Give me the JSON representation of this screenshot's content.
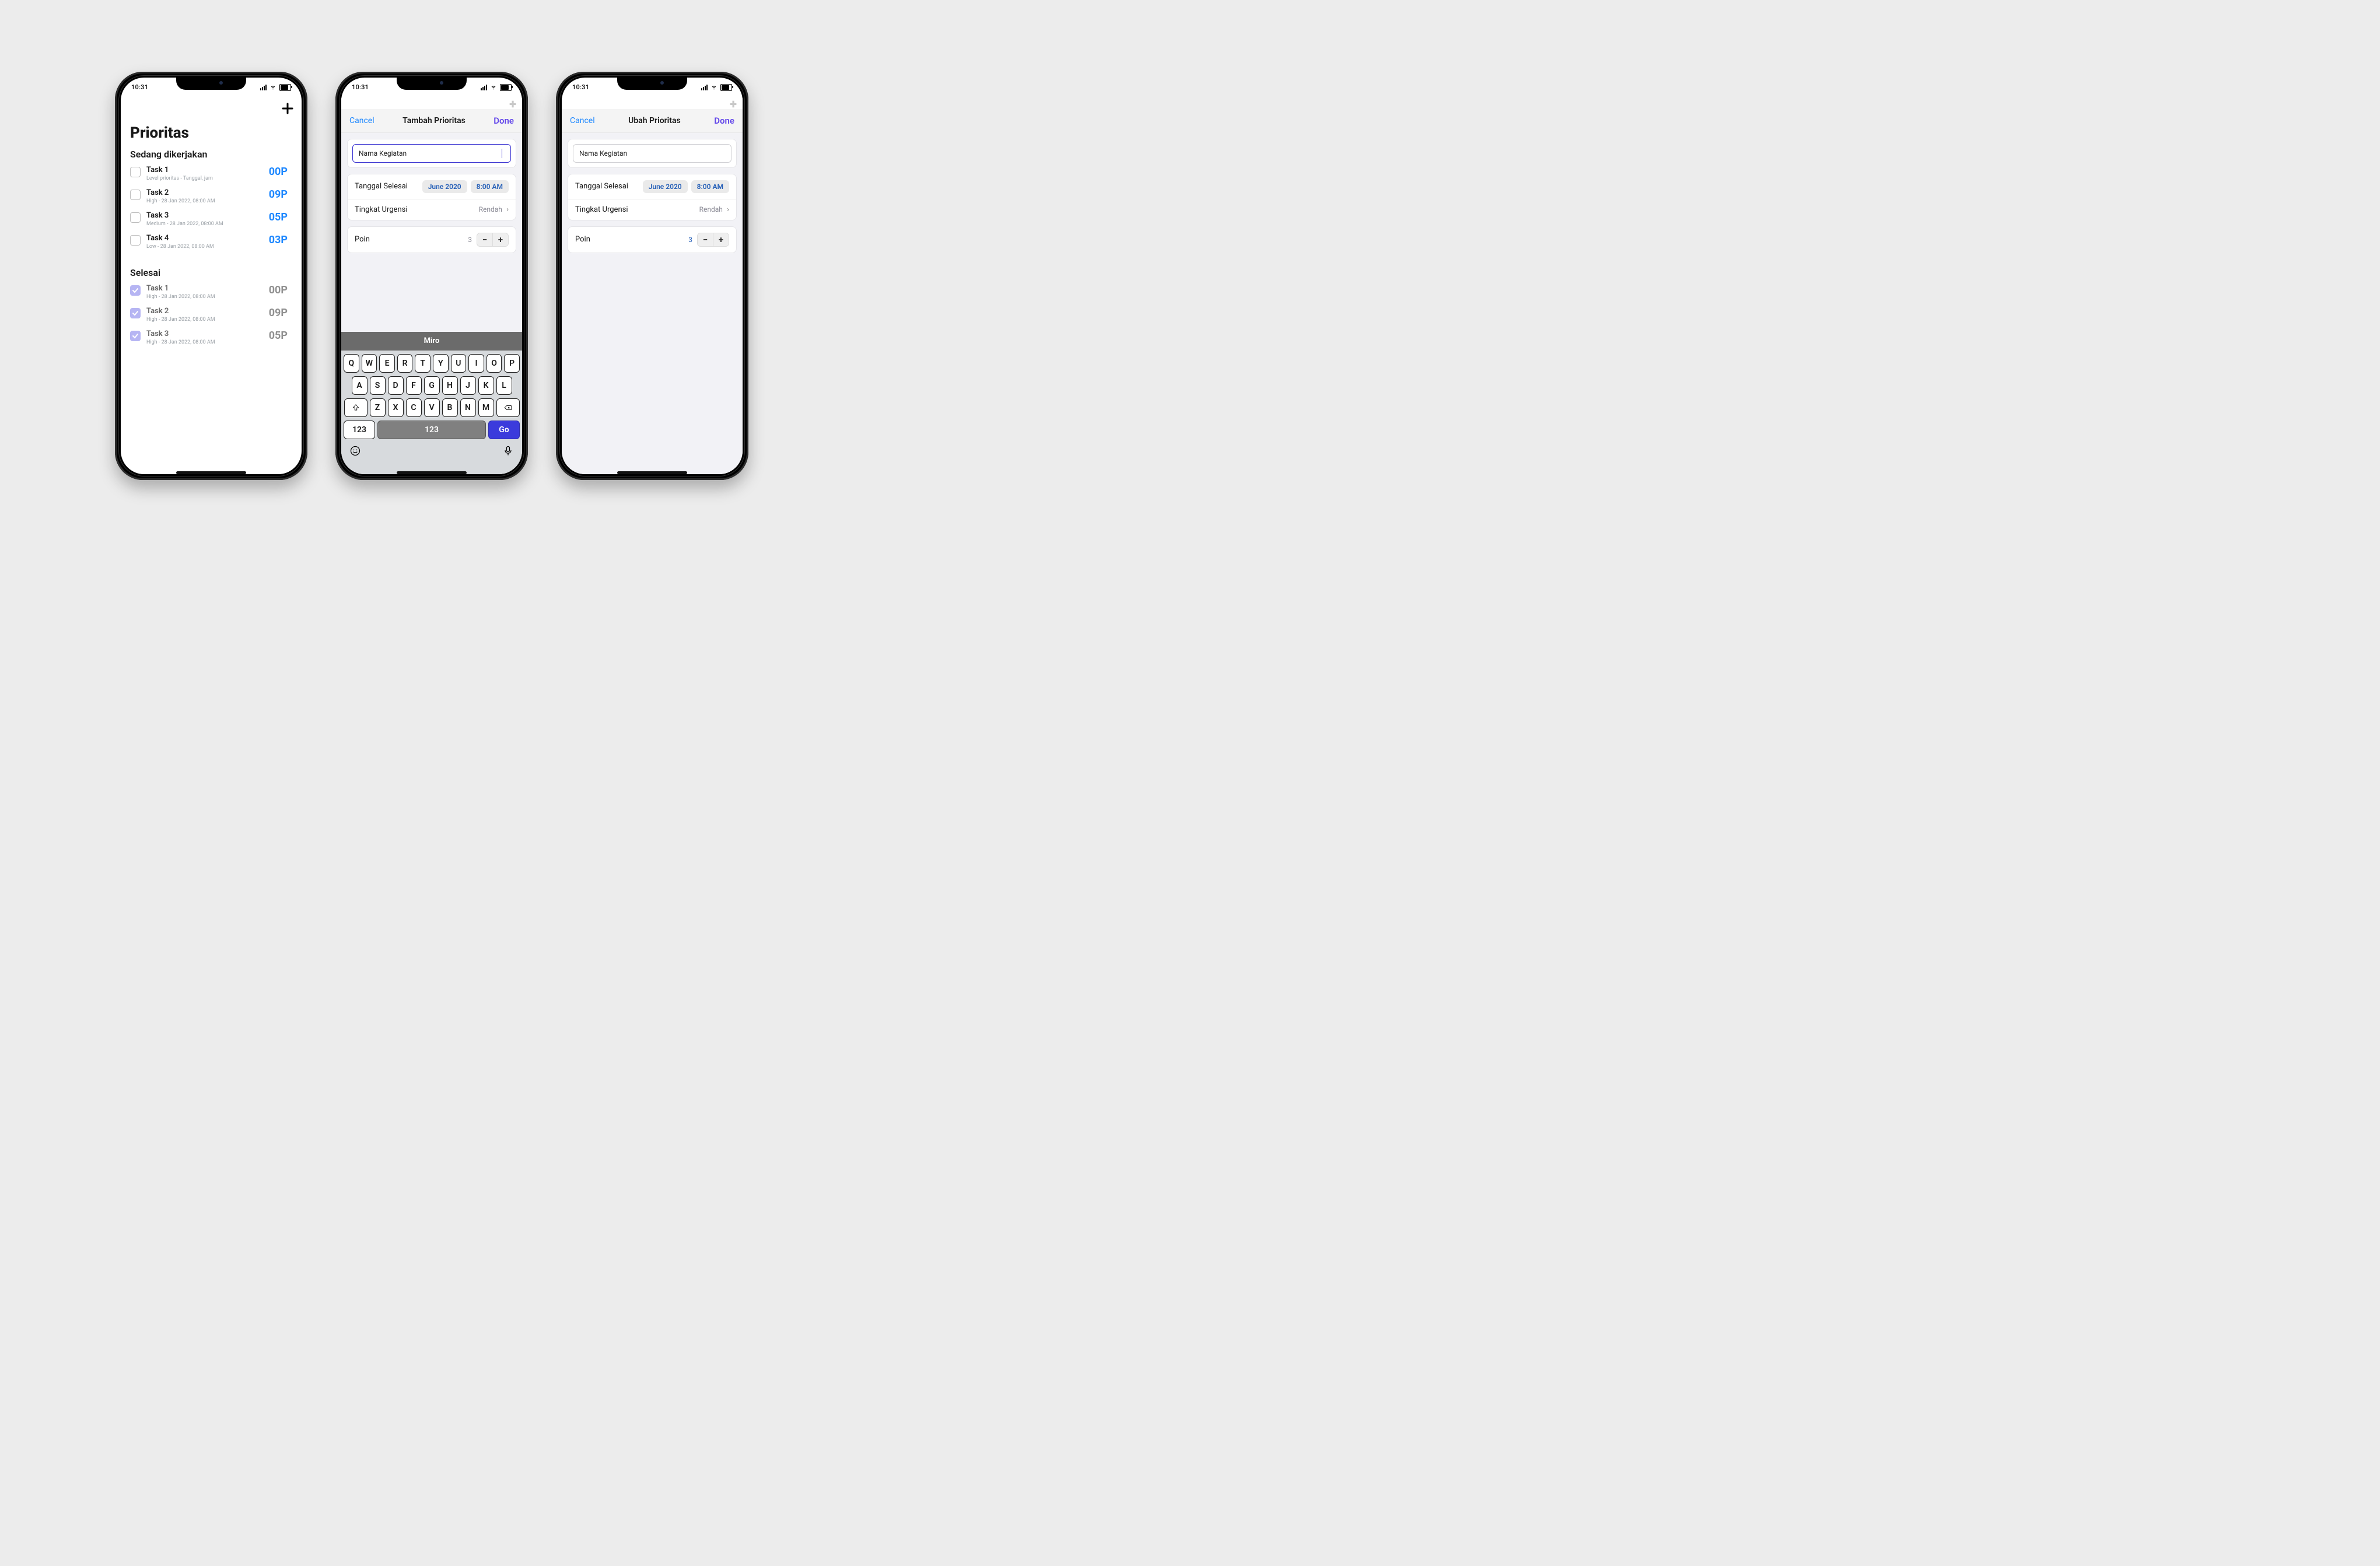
{
  "status": {
    "time": "10:31"
  },
  "screen1": {
    "title": "Prioritas",
    "sections": {
      "working": {
        "title": "Sedang dikerjakan",
        "tasks": [
          {
            "name": "Task 1",
            "meta": "Level prioritas - Tanggal, jam",
            "points": "00P"
          },
          {
            "name": "Task 2",
            "meta": "High - 28 Jan 2022, 08:00 AM",
            "points": "09P"
          },
          {
            "name": "Task 3",
            "meta": "Medium - 28 Jan 2022, 08:00 AM",
            "points": "05P"
          },
          {
            "name": "Task 4",
            "meta": "Low - 28 Jan 2022, 08:00 AM",
            "points": "03P"
          }
        ]
      },
      "done": {
        "title": "Selesai",
        "tasks": [
          {
            "name": "Task 1",
            "meta": "High - 28 Jan 2022, 08:00 AM",
            "points": "00P"
          },
          {
            "name": "Task 2",
            "meta": "High - 28 Jan 2022, 08:00 AM",
            "points": "09P"
          },
          {
            "name": "Task 3",
            "meta": "High - 28 Jan 2022, 08:00 AM",
            "points": "05P"
          }
        ]
      }
    }
  },
  "screen2": {
    "header": {
      "cancel": "Cancel",
      "title": "Tambah Prioritas",
      "done": "Done"
    },
    "name_input": {
      "placeholder": "Nama Kegiatan",
      "value": ""
    },
    "date": {
      "label": "Tanggal Selesai",
      "month": "June 2020",
      "time": "8:00 AM"
    },
    "urgency": {
      "label": "Tingkat Urgensi",
      "value": "Rendah"
    },
    "points": {
      "label": "Poin",
      "value": "3"
    },
    "keyboard": {
      "suggestion": "Miro",
      "row1": [
        "Q",
        "W",
        "E",
        "R",
        "T",
        "Y",
        "U",
        "I",
        "O",
        "P"
      ],
      "row2": [
        "A",
        "S",
        "D",
        "F",
        "G",
        "H",
        "J",
        "K",
        "L"
      ],
      "row3": [
        "Z",
        "X",
        "C",
        "V",
        "B",
        "N",
        "M"
      ],
      "key_123": "123",
      "key_space": "123",
      "key_go": "Go"
    }
  },
  "screen3": {
    "header": {
      "cancel": "Cancel",
      "title": "Ubah Prioritas",
      "done": "Done"
    },
    "name_input": {
      "placeholder": "Nama Kegiatan",
      "value": ""
    },
    "date": {
      "label": "Tanggal Selesai",
      "month": "June 2020",
      "time": "8:00 AM"
    },
    "urgency": {
      "label": "Tingkat Urgensi",
      "value": "Rendah"
    },
    "points": {
      "label": "Poin",
      "value": "3"
    }
  }
}
